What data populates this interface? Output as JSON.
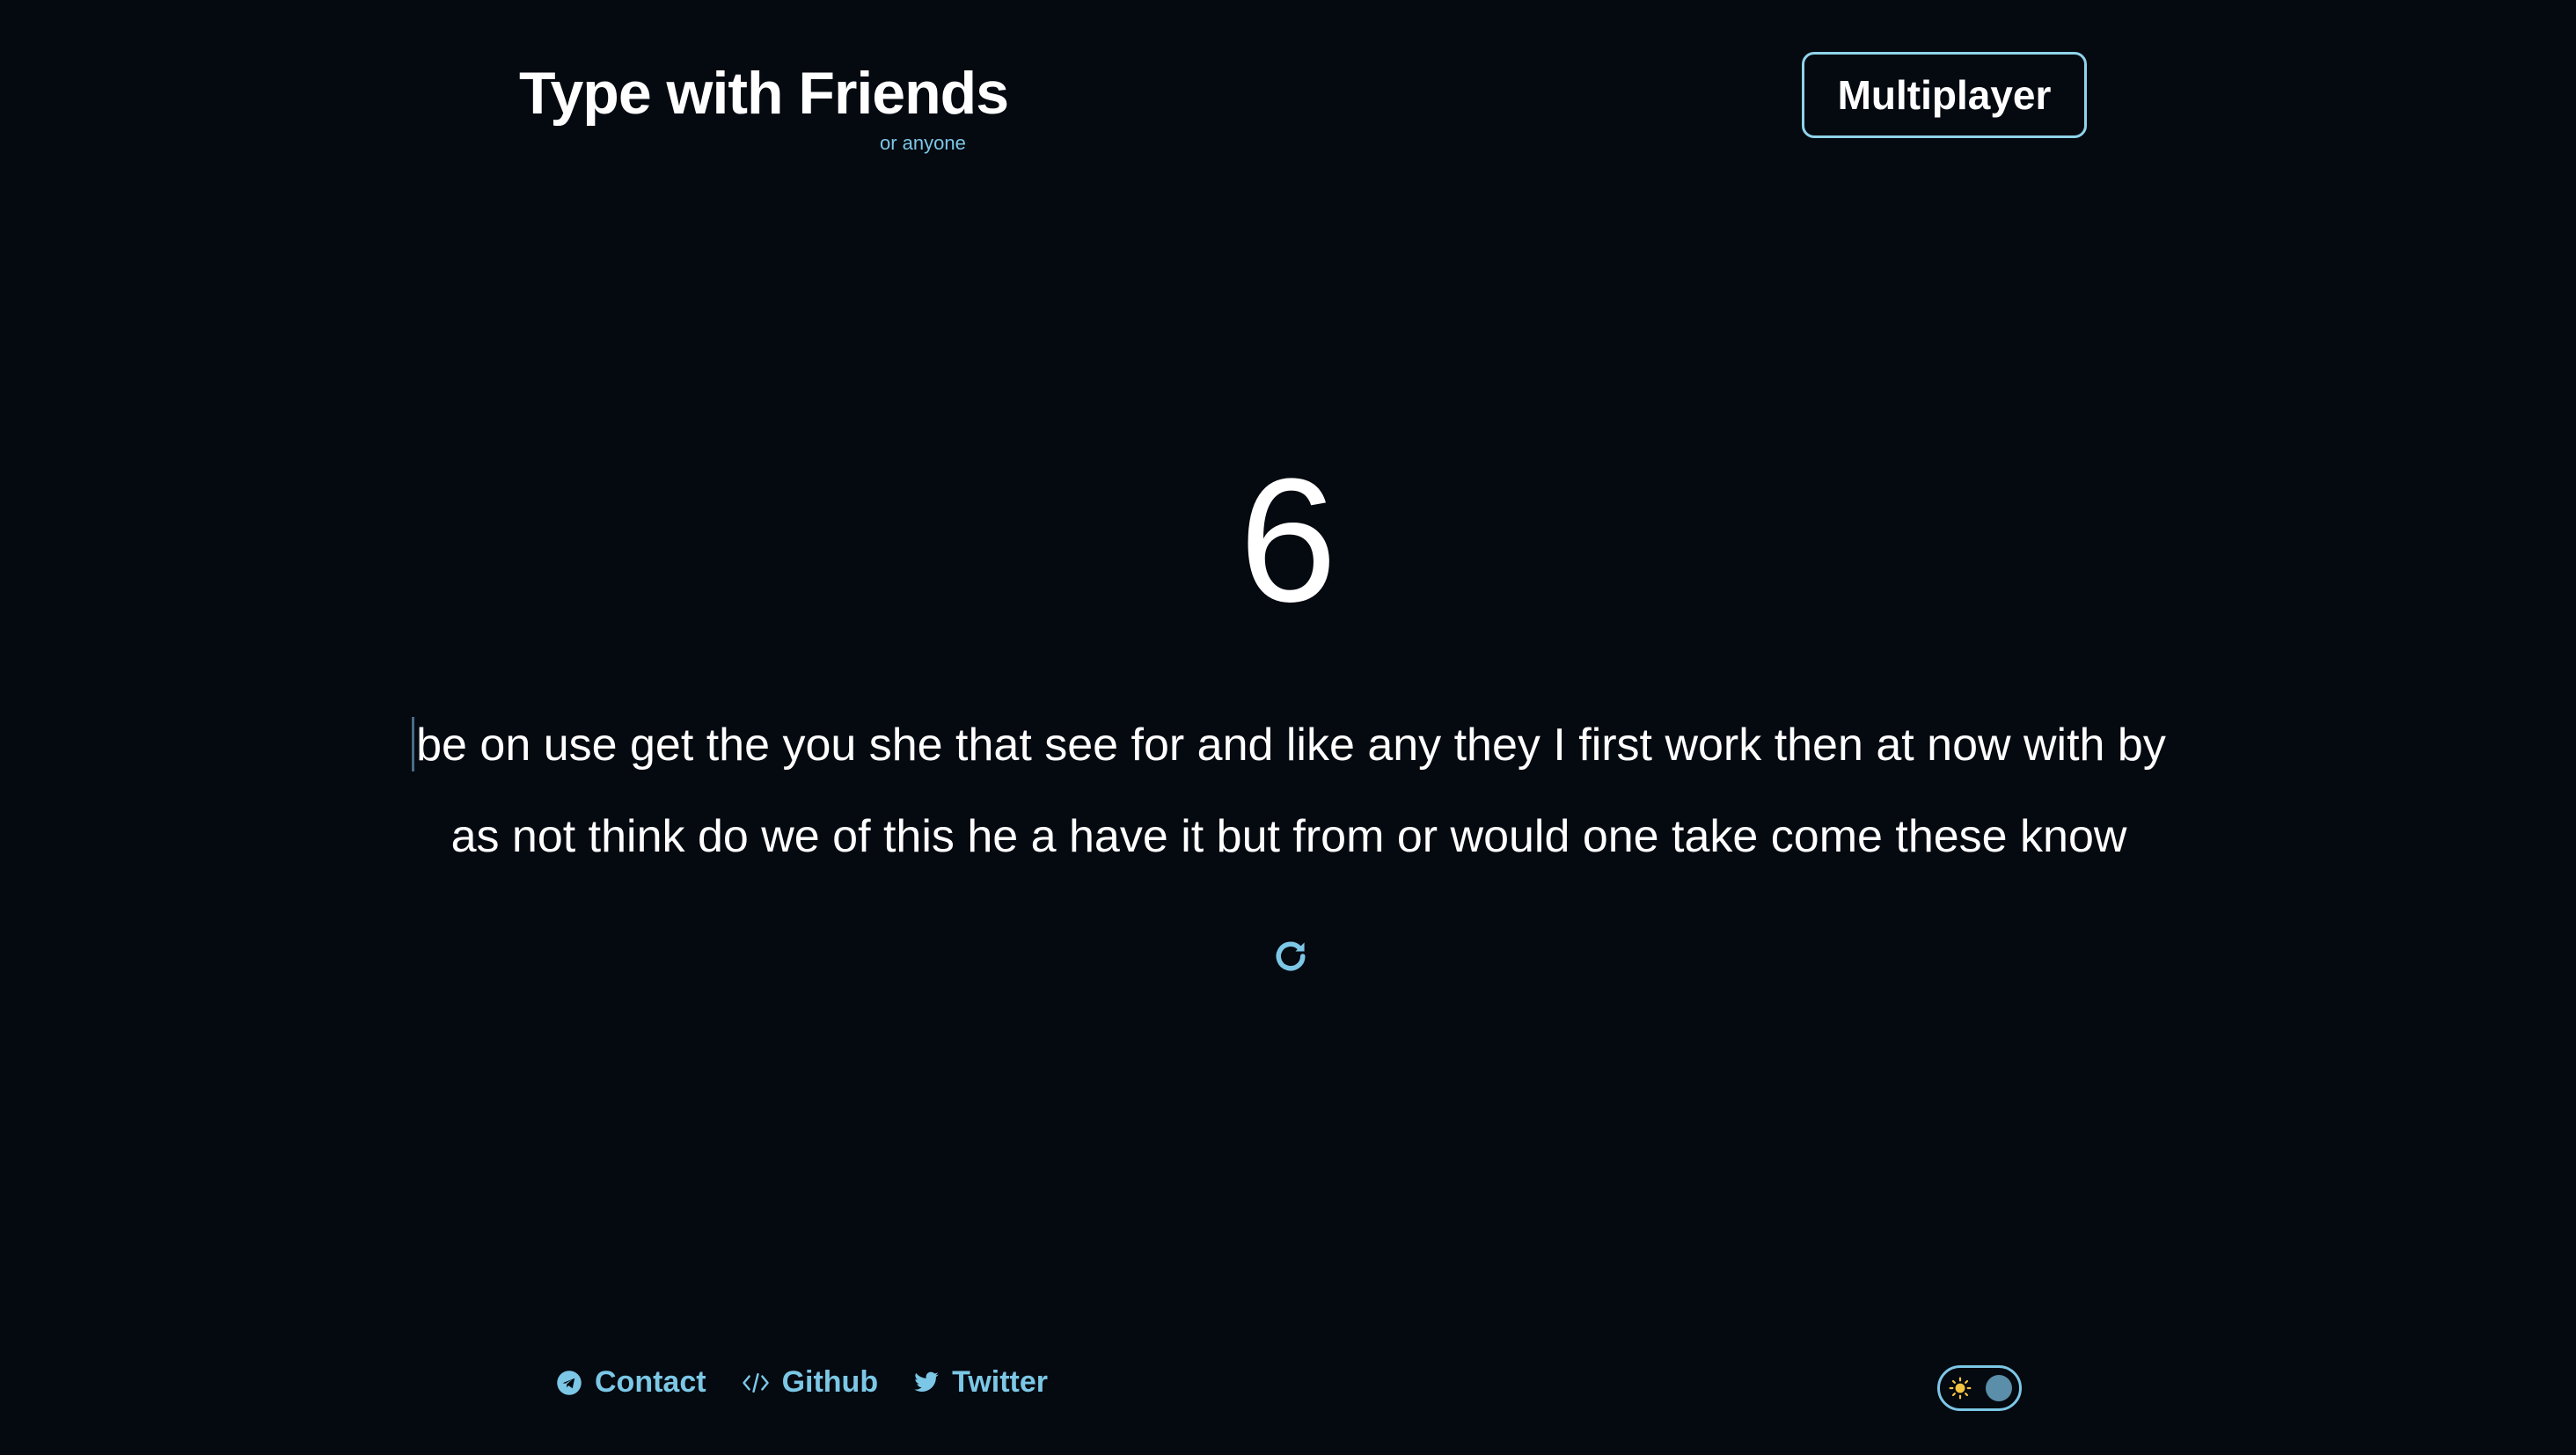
{
  "header": {
    "title": "Type with Friends",
    "subtitle": "or anyone",
    "multiplayer_label": "Multiplayer"
  },
  "countdown": "6",
  "words": {
    "line1": "be on use get the you she that see for and like any they I first work then at now with by",
    "line2": "as not think do we of this he a have it but from or would one take come these know"
  },
  "restart_icon": "refresh-icon",
  "footer": {
    "links": [
      {
        "label": "Contact",
        "icon": "telegram-icon"
      },
      {
        "label": "Github",
        "icon": "code-icon"
      },
      {
        "label": "Twitter",
        "icon": "twitter-icon"
      }
    ]
  },
  "theme_toggle": {
    "icon": "sun-icon",
    "state": "dark"
  },
  "colors": {
    "background": "#050910",
    "accent": "#7cc7e6",
    "text": "#ffffff",
    "sun": "#f5c542"
  }
}
